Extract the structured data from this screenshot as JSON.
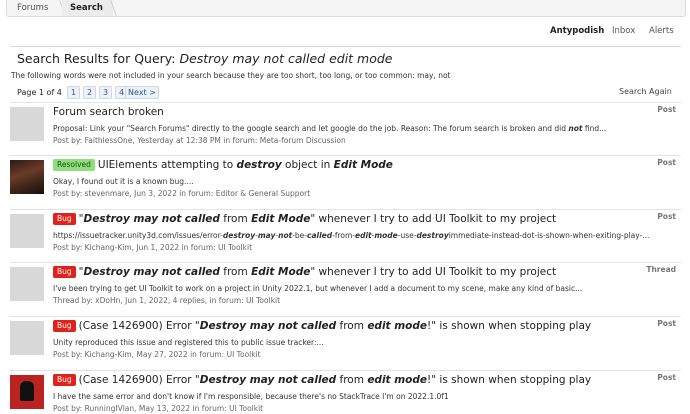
{
  "breadcrumb": {
    "forums": "Forums",
    "search": "Search"
  },
  "userbar": {
    "username": "Antypodish",
    "inbox": "Inbox",
    "alerts": "Alerts"
  },
  "page": {
    "title_prefix": "Search Results for Query: ",
    "query": "Destroy may not called edit mode"
  },
  "notice": "The following words were not included in your search because they are too short, too long, or too common: may, not",
  "pager": {
    "label": "Page 1 of 4",
    "pages": [
      "1",
      "2",
      "3",
      "4"
    ],
    "next": "Next >"
  },
  "search_again": "Search Again",
  "results": [
    {
      "kind": "Post",
      "title": "Forum search broken",
      "snippet_html": "Proposal: Link your \"Search Forums\" directly to the google search and let google do the job. Reason: The forum search is broken and did <b>not</b> find...",
      "meta": "Post by: FaithlessOne, Yesterday at 12:38 PM in forum: Meta-forum Discussion"
    },
    {
      "kind": "Post",
      "badge": "Resolved",
      "title_html": "UIElements attempting to <b><i>destroy</i></b> object in <b><i>Edit Mode</i></b>",
      "snippet_html": "Okay, I found out it is a known bug....",
      "meta": "Post by: stevenmare, Jun 3, 2022 in forum: Editor & General Support"
    },
    {
      "kind": "Post",
      "badge": "Bug",
      "title_html": "\"<b><i>Destroy may not</i></b> <b><i>called</i></b> from <b><i>Edit Mode</i></b>\" whenever I try to add UI Toolkit to my project",
      "snippet_html": "https://issuetracker.unity3d.com/issues/error-<b>destroy</b>-<b>may</b>-<b>not</b>-be-<b>called</b>-from-<b>edit</b>-<b>mode</b>-use-<b>destroy</b>immediate-instead-dot-is-shown-when-exiting-play-...",
      "meta": "Post by: Kichang-Kim, Jun 1, 2022 in forum: UI Toolkit"
    },
    {
      "kind": "Thread",
      "badge": "Bug",
      "title_html": "\"<b><i>Destroy may not</i></b> <b><i>called</i></b> from <b><i>Edit Mode</i></b>\" whenever I try to add UI Toolkit to my project",
      "snippet_html": "I've been trying to get UI Toolkit to work on a project in Unity 2022.1, but whenever I add a document to my scene, make any kind of basic...",
      "meta": "Thread by: xDoHn, Jun 1, 2022, 4 replies, in forum: UI Toolkit"
    },
    {
      "kind": "Post",
      "badge": "Bug",
      "title_html": "(Case 1426900) Error \"<b><i>Destroy may not</i></b> <b><i>called</i></b> from <b><i>edit mode</i></b>!\" is shown when stopping play",
      "snippet_html": "Unity reproduced this issue and registered this to public issue tracker:...",
      "meta": "Post by: Kichang-Kim, May 27, 2022 in forum: UI Toolkit"
    },
    {
      "kind": "Post",
      "badge": "Bug",
      "title_html": "(Case 1426900) Error \"<b><i>Destroy may not</i></b> <b><i>called</i></b> from <b><i>edit mode</i></b>!\" is shown when stopping play",
      "snippet_html": "I have the same error and don't know if I'm responsible, because there's no StackTrace I'm on 2022.1.0f1",
      "meta": "Post by: RunningIVlan, May 13, 2022 in forum: UI Toolkit"
    }
  ]
}
